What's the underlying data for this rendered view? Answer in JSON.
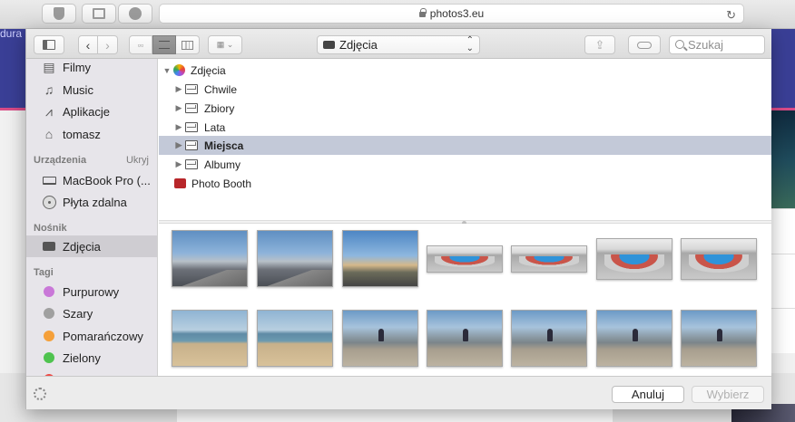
{
  "browser": {
    "address": "photos3.eu",
    "page_partial_text": "dura"
  },
  "toolbar": {
    "location": "Zdjęcia",
    "search_placeholder": "Szukaj"
  },
  "sidebar": {
    "favorites": [
      {
        "label": "Filmy",
        "icon": "film-icon"
      },
      {
        "label": "Music",
        "icon": "music-note-icon"
      },
      {
        "label": "Aplikacje",
        "icon": "applications-icon"
      },
      {
        "label": "tomasz",
        "icon": "home-icon"
      }
    ],
    "devices_heading": "Urządzenia",
    "devices_hide": "Ukryj",
    "devices": [
      {
        "label": "MacBook Pro (...",
        "icon": "laptop-icon"
      },
      {
        "label": "Płyta zdalna",
        "icon": "disc-icon"
      }
    ],
    "media_heading": "Nośnik",
    "media": [
      {
        "label": "Zdjęcia",
        "icon": "camera-icon",
        "selected": true
      }
    ],
    "tags_heading": "Tagi",
    "tags": [
      {
        "label": "Purpurowy",
        "color": "#c978d8"
      },
      {
        "label": "Szary",
        "color": "#a0a0a0"
      },
      {
        "label": "Pomarańczowy",
        "color": "#f5a03a"
      },
      {
        "label": "Zielony",
        "color": "#4fc34f"
      },
      {
        "label": "",
        "color": "#ec4a45"
      }
    ]
  },
  "tree": {
    "root": "Zdjęcia",
    "items": [
      {
        "label": "Chwile"
      },
      {
        "label": "Zbiory"
      },
      {
        "label": "Lata"
      },
      {
        "label": "Miejsca",
        "selected": true
      },
      {
        "label": "Albumy"
      }
    ],
    "photo_booth": "Photo Booth"
  },
  "buttons": {
    "cancel": "Anuluj",
    "choose": "Wybierz"
  }
}
